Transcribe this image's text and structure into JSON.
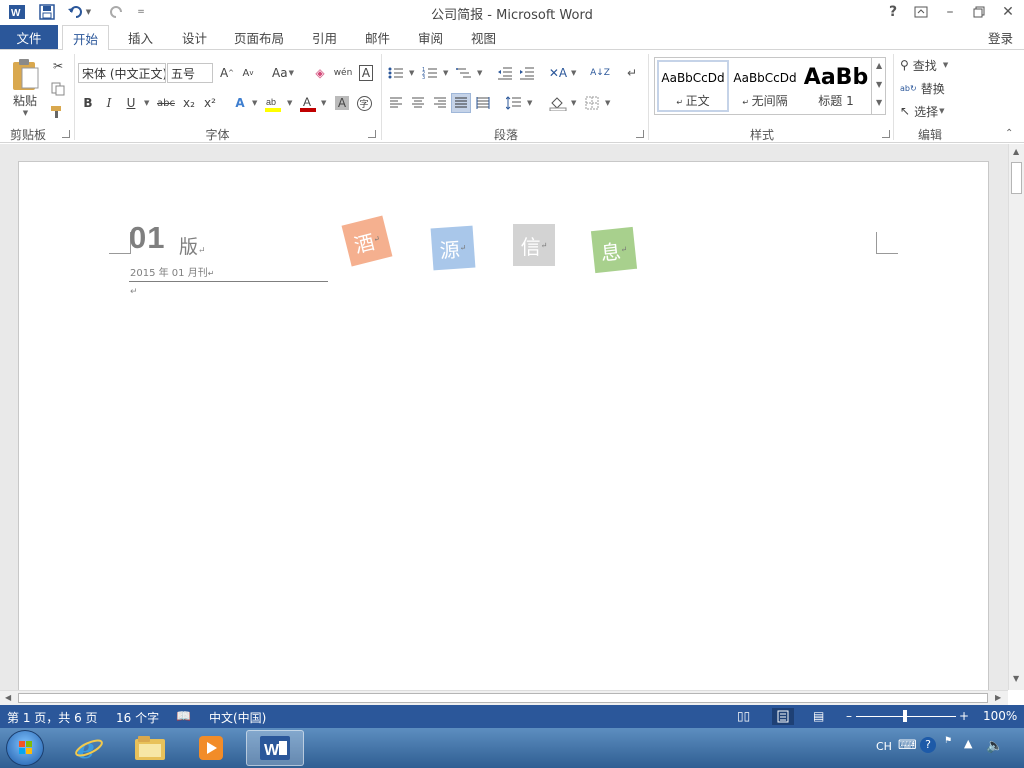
{
  "window": {
    "title": "公司简报 - Microsoft Word",
    "help": "?"
  },
  "tabs": [
    {
      "label": "文件"
    },
    {
      "label": "开始"
    },
    {
      "label": "插入"
    },
    {
      "label": "设计"
    },
    {
      "label": "页面布局"
    },
    {
      "label": "引用"
    },
    {
      "label": "邮件"
    },
    {
      "label": "审阅"
    },
    {
      "label": "视图"
    }
  ],
  "signin": "登录",
  "ribbon": {
    "clipboard": {
      "paste": "粘贴",
      "group": "剪贴板"
    },
    "font": {
      "name": "宋体 (中文正文)",
      "size": "五号",
      "group": "字体",
      "change_case": "Aa",
      "bold": "B",
      "italic": "I",
      "underline": "U",
      "strike": "abc",
      "sub": "x₂",
      "sup": "x²",
      "pinyin": "wén",
      "border_char": "A"
    },
    "paragraph": {
      "group": "段落"
    },
    "styles": {
      "group": "样式",
      "items": [
        {
          "preview": "AaBbCcDd",
          "name": "正文"
        },
        {
          "preview": "AaBbCcDd",
          "name": "无间隔"
        },
        {
          "preview": "AaBb",
          "name": "标题 1"
        }
      ]
    },
    "editing": {
      "group": "编辑",
      "find": "查找",
      "replace": "替换",
      "select": "选择"
    }
  },
  "document": {
    "issue_number": "01",
    "issue_suffix": "版",
    "date_line": "2015 年 01 月刊",
    "tiles": [
      "酒",
      "源",
      "信",
      "息"
    ],
    "tile_colors": [
      "#f5b08f",
      "#a9c7ea",
      "#d3d3d3",
      "#a8d08d"
    ]
  },
  "status": {
    "page": "第 1 页，共 6 页",
    "words": "16 个字",
    "lang": "中文(中国)",
    "zoom": "100%"
  },
  "taskbar": {
    "tray_lang": "CH"
  }
}
